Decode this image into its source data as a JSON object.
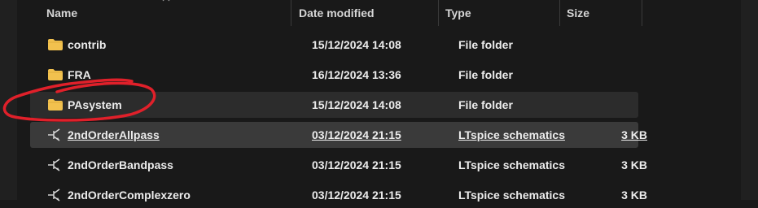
{
  "columns": {
    "name": "Name",
    "date": "Date modified",
    "type": "Type",
    "size": "Size"
  },
  "rows": [
    {
      "name": "contrib",
      "date": "15/12/2024 14:08",
      "type": "File folder",
      "size": "",
      "icon": "folder-icon"
    },
    {
      "name": "FRA",
      "date": "16/12/2024 13:36",
      "type": "File folder",
      "size": "",
      "icon": "folder-icon"
    },
    {
      "name": "PAsystem",
      "date": "15/12/2024 14:08",
      "type": "File folder",
      "size": "",
      "icon": "folder-icon",
      "state": "hover"
    },
    {
      "name": "2ndOrderAllpass",
      "date": "03/12/2024 21:15",
      "type": "LTspice schematics",
      "size": "3 KB",
      "icon": "ltspice-schematic-icon",
      "state": "selected"
    },
    {
      "name": "2ndOrderBandpass",
      "date": "03/12/2024 21:15",
      "type": "LTspice schematics",
      "size": "3 KB",
      "icon": "ltspice-schematic-icon"
    },
    {
      "name": "2ndOrderComplexzero",
      "date": "03/12/2024 21:15",
      "type": "LTspice schematics",
      "size": "3 KB",
      "icon": "ltspice-schematic-icon"
    }
  ],
  "colors": {
    "folder": "#f2c14e",
    "annotation": "#e0202a"
  }
}
